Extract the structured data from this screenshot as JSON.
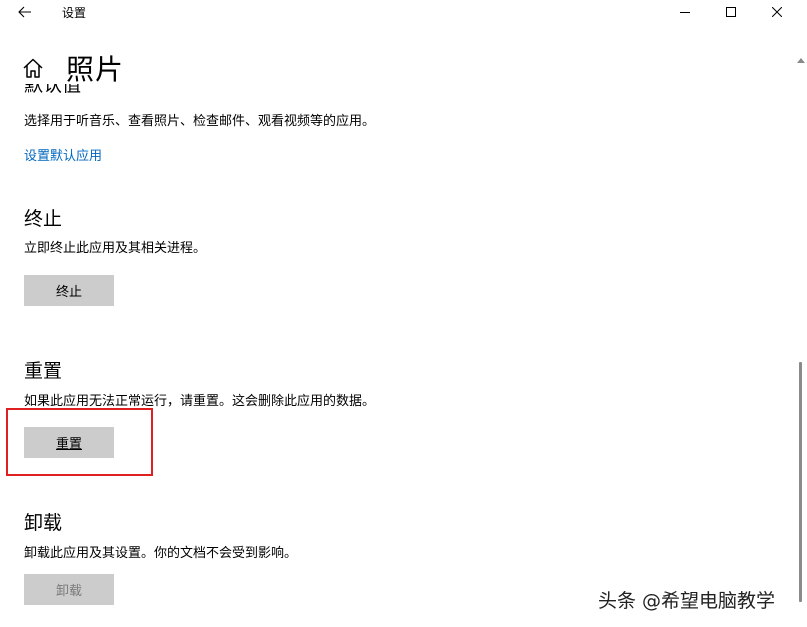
{
  "window": {
    "title": "设置",
    "back_icon": "arrow-left-icon",
    "minimize_icon": "minimize-icon",
    "maximize_icon": "maximize-icon",
    "close_icon": "close-icon"
  },
  "header": {
    "home_icon": "home-icon",
    "title": "照片"
  },
  "sections": {
    "defaults": {
      "title": "默认值",
      "description": "选择用于听音乐、查看照片、检查邮件、观看视频等的应用。",
      "link": "设置默认应用"
    },
    "terminate": {
      "title": "终止",
      "description": "立即终止此应用及其相关进程。",
      "button": "终止"
    },
    "reset": {
      "title": "重置",
      "description": "如果此应用无法正常运行，请重置。这会删除此应用的数据。",
      "button": "重置"
    },
    "uninstall": {
      "title": "卸载",
      "description": "卸载此应用及其设置。你的文档不会受到影响。",
      "button": "卸载",
      "button_disabled": true
    }
  },
  "watermark": "头条 @希望电脑教学",
  "colors": {
    "link": "#0067c0",
    "button_bg": "#cccccc",
    "highlight": "#e02020"
  }
}
